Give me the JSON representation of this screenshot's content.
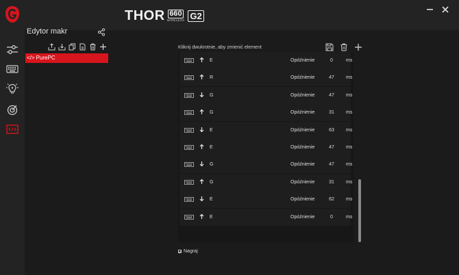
{
  "app": {
    "product_name": "THOR",
    "product_model": "660",
    "product_sub": "WIRELESS",
    "product_gen": "G2",
    "accent_color": "#d6151c"
  },
  "window": {
    "minimize_icon": "minimize-icon",
    "close_icon": "close-icon"
  },
  "sidebar": {
    "items": [
      {
        "icon": "sliders-icon",
        "active": false
      },
      {
        "icon": "keyboard-icon",
        "active": false
      },
      {
        "icon": "lightbulb-icon",
        "active": false
      },
      {
        "icon": "target-icon",
        "active": false
      },
      {
        "icon": "macro-icon",
        "active": true
      }
    ]
  },
  "macro_panel": {
    "title": "Edytor makr",
    "toolbar": [
      "export-icon",
      "import-icon",
      "copy-icon",
      "paste-icon",
      "delete-icon",
      "add-icon"
    ],
    "macros": [
      {
        "prefix": "</>",
        "name": "PurePC",
        "selected": true
      }
    ]
  },
  "editor": {
    "hint": "Kliknij dwukrotnie, aby zmienić element",
    "toolbar": [
      "save-icon",
      "delete-icon",
      "add-icon"
    ],
    "delay_label": "Opóźnienie",
    "unit": "ms",
    "steps": [
      {
        "direction": "up",
        "key": "E",
        "delay": "0"
      },
      {
        "direction": "up",
        "key": "R",
        "delay": "47"
      },
      {
        "direction": "down",
        "key": "G",
        "delay": "47"
      },
      {
        "direction": "up",
        "key": "G",
        "delay": "31"
      },
      {
        "direction": "down",
        "key": "E",
        "delay": "63"
      },
      {
        "direction": "up",
        "key": "E",
        "delay": "47"
      },
      {
        "direction": "down",
        "key": "G",
        "delay": "47"
      },
      {
        "direction": "up",
        "key": "G",
        "delay": "31"
      },
      {
        "direction": "down",
        "key": "E",
        "delay": "62"
      },
      {
        "direction": "up",
        "key": "E",
        "delay": "0"
      }
    ],
    "record_label": "Nagraj",
    "record_checked": true
  }
}
